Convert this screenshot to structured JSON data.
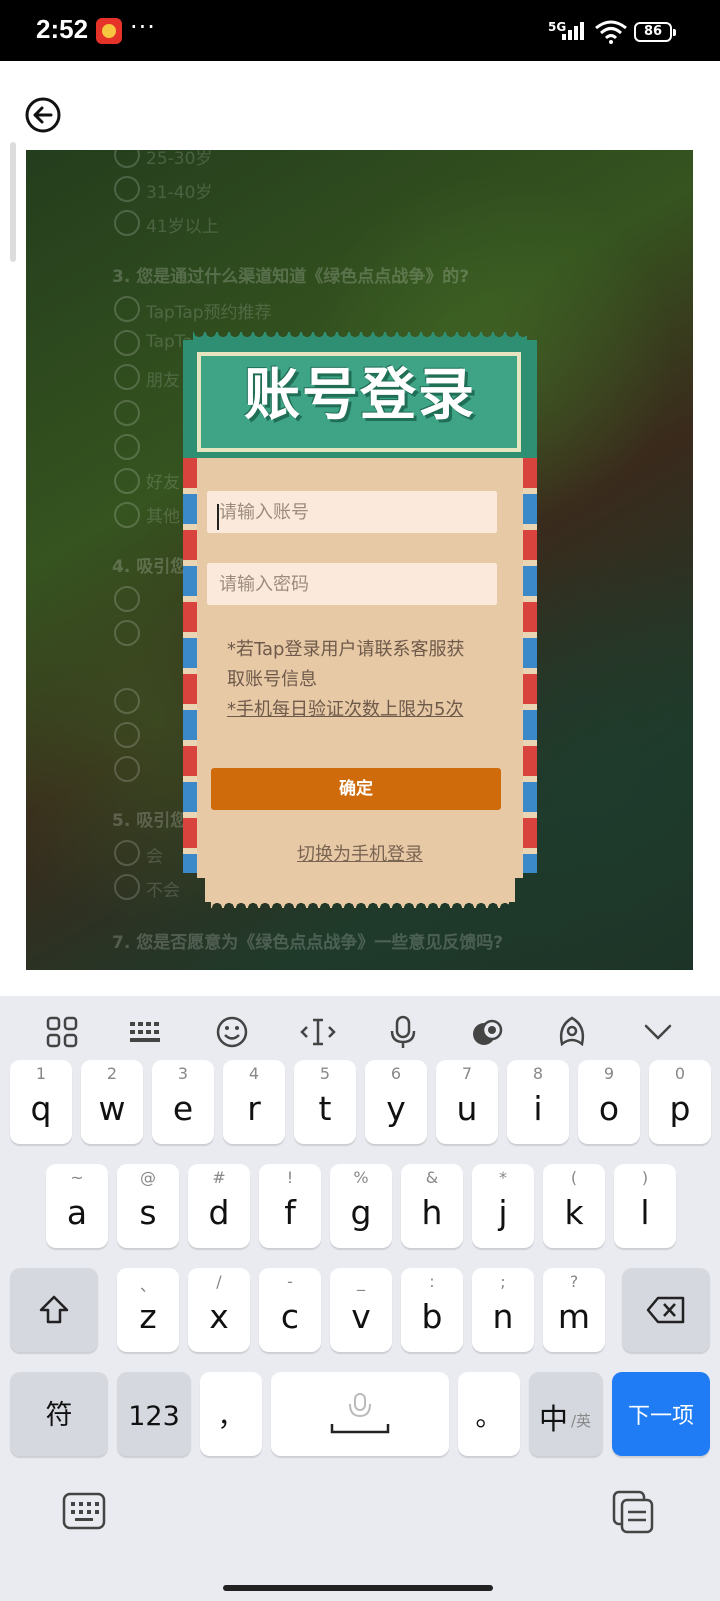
{
  "status_bar": {
    "time": "2:52",
    "dots": "···",
    "network": "5G",
    "battery": "86"
  },
  "background_form": {
    "options_group1": [
      "25-30岁",
      "31-40岁",
      "41岁以上"
    ],
    "question3": "3. 您是通过什么渠道知道《绿色点点战争》的?",
    "options_group2": [
      "TapTap预约推荐",
      "TapTap",
      "朋友",
      "",
      "",
      "好友",
      "其他"
    ],
    "question4": "4. 吸引您",
    "question5": "5. 吸引您",
    "options_group3": [
      "会",
      "不会"
    ],
    "question7": "7. 您是否愿意为《绿色点点战争》一些意见反馈吗?"
  },
  "login_card": {
    "title": "账号登录",
    "account_placeholder": "请输入账号",
    "password_placeholder": "请输入密码",
    "note_line1": "*若Tap登录用户请联系客服获",
    "note_line2": "取账号信息",
    "note_line3": "*手机每日验证次数上限为5次",
    "confirm_label": "确定",
    "switch_label": "切换为手机登录"
  },
  "keyboard": {
    "row1": [
      {
        "k": "q",
        "s": "1"
      },
      {
        "k": "w",
        "s": "2"
      },
      {
        "k": "e",
        "s": "3"
      },
      {
        "k": "r",
        "s": "4"
      },
      {
        "k": "t",
        "s": "5"
      },
      {
        "k": "y",
        "s": "6"
      },
      {
        "k": "u",
        "s": "7"
      },
      {
        "k": "i",
        "s": "8"
      },
      {
        "k": "o",
        "s": "9"
      },
      {
        "k": "p",
        "s": "0"
      }
    ],
    "row2": [
      {
        "k": "a",
        "s": "~"
      },
      {
        "k": "s",
        "s": "@"
      },
      {
        "k": "d",
        "s": "#"
      },
      {
        "k": "f",
        "s": "!"
      },
      {
        "k": "g",
        "s": "%"
      },
      {
        "k": "h",
        "s": "&"
      },
      {
        "k": "j",
        "s": "*"
      },
      {
        "k": "k",
        "s": "("
      },
      {
        "k": "l",
        "s": ")"
      }
    ],
    "row3": [
      {
        "k": "z",
        "s": "、"
      },
      {
        "k": "x",
        "s": "/"
      },
      {
        "k": "c",
        "s": "-"
      },
      {
        "k": "v",
        "s": "_"
      },
      {
        "k": "b",
        "s": ":"
      },
      {
        "k": "n",
        "s": ";"
      },
      {
        "k": "m",
        "s": "?"
      }
    ],
    "symbols_label": "符",
    "numbers_label": "123",
    "comma_label": "，",
    "period_label": "。",
    "lang_main": "中",
    "lang_sub": "/英",
    "next_label": "下一项"
  },
  "colors": {
    "accent_orange": "#cf6b0b",
    "ticket_green": "#2f8f72",
    "next_blue": "#1f7cf5"
  }
}
